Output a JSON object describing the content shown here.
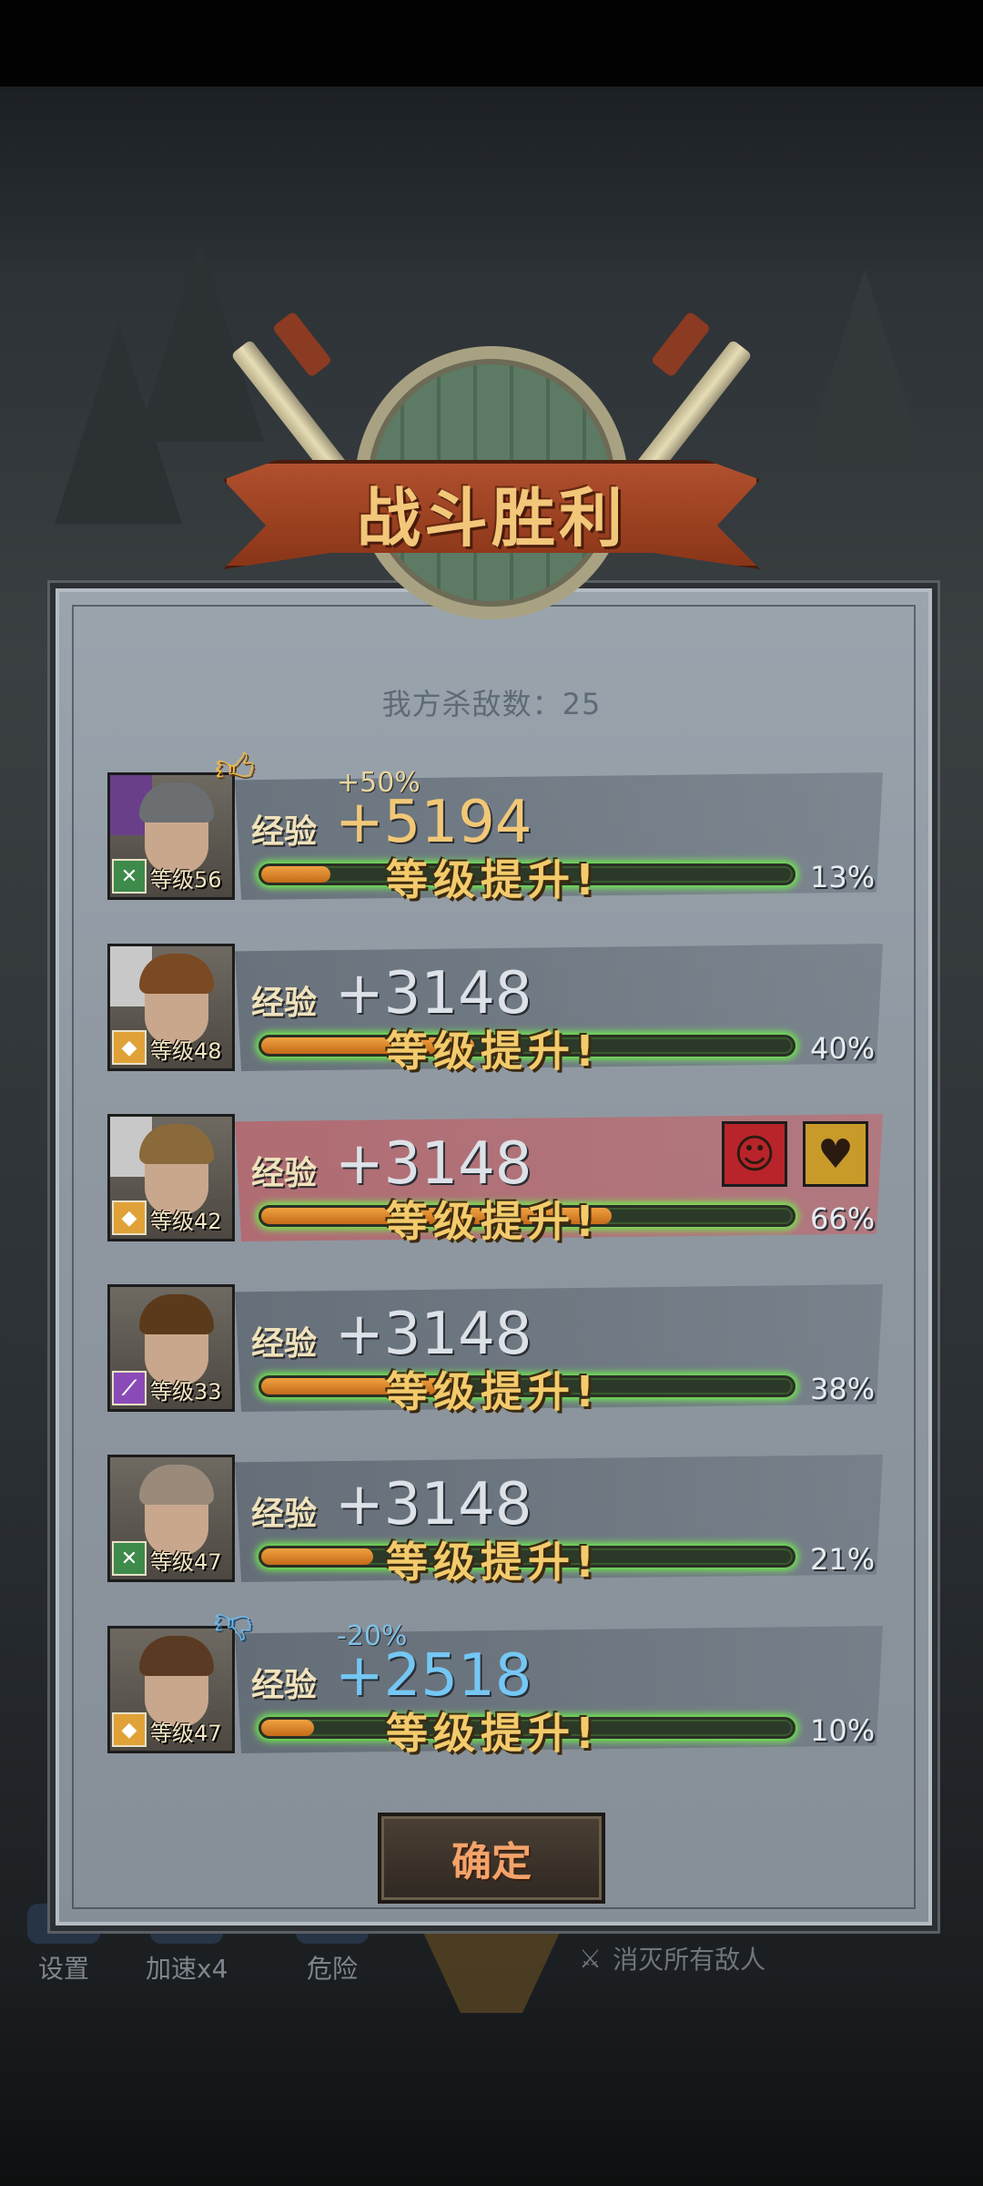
{
  "title": "战斗胜利",
  "kill_count": "我方杀敌数：25",
  "exp_label": "经验",
  "level_up_text": "等级提升!",
  "confirm_label": "确定",
  "heroes": [
    {
      "level": "等级56",
      "role": "tactician",
      "bonus": "+50%",
      "bonus_type": "up",
      "exp": "+5194",
      "exp_style": "gold",
      "progress_pct": 13,
      "progress_text": "13%"
    },
    {
      "level": "等级48",
      "role": "defender",
      "bonus": "",
      "bonus_type": "",
      "exp": "+3148",
      "exp_style": "normal",
      "progress_pct": 40,
      "progress_text": "40%"
    },
    {
      "level": "等级42",
      "role": "defender",
      "bonus": "",
      "bonus_type": "",
      "exp": "+3148",
      "exp_style": "normal",
      "progress_pct": 66,
      "progress_text": "66%",
      "status_effects": [
        "bandaged-head-icon",
        "broken-heart-icon"
      ]
    },
    {
      "level": "等级33",
      "role": "mage",
      "bonus": "",
      "bonus_type": "",
      "exp": "+3148",
      "exp_style": "normal",
      "progress_pct": 38,
      "progress_text": "38%"
    },
    {
      "level": "等级47",
      "role": "tactician",
      "bonus": "",
      "bonus_type": "",
      "exp": "+3148",
      "exp_style": "normal",
      "progress_pct": 21,
      "progress_text": "21%"
    },
    {
      "level": "等级47",
      "role": "defender",
      "bonus": "-20%",
      "bonus_type": "down",
      "exp": "+2518",
      "exp_style": "blue",
      "progress_pct": 10,
      "progress_text": "10%"
    }
  ],
  "hud": {
    "settings_label": "设置",
    "speed_label": "加速x4",
    "danger_label": "危险",
    "mission_label": "消灭所有敌人"
  },
  "colors": {
    "title_gold": "#f2c77a",
    "bar_glow": "#6ff24a",
    "bar_fill": "#f0a242",
    "debuff_row": "#c85a60",
    "confirm_text": "#f3a36a"
  }
}
